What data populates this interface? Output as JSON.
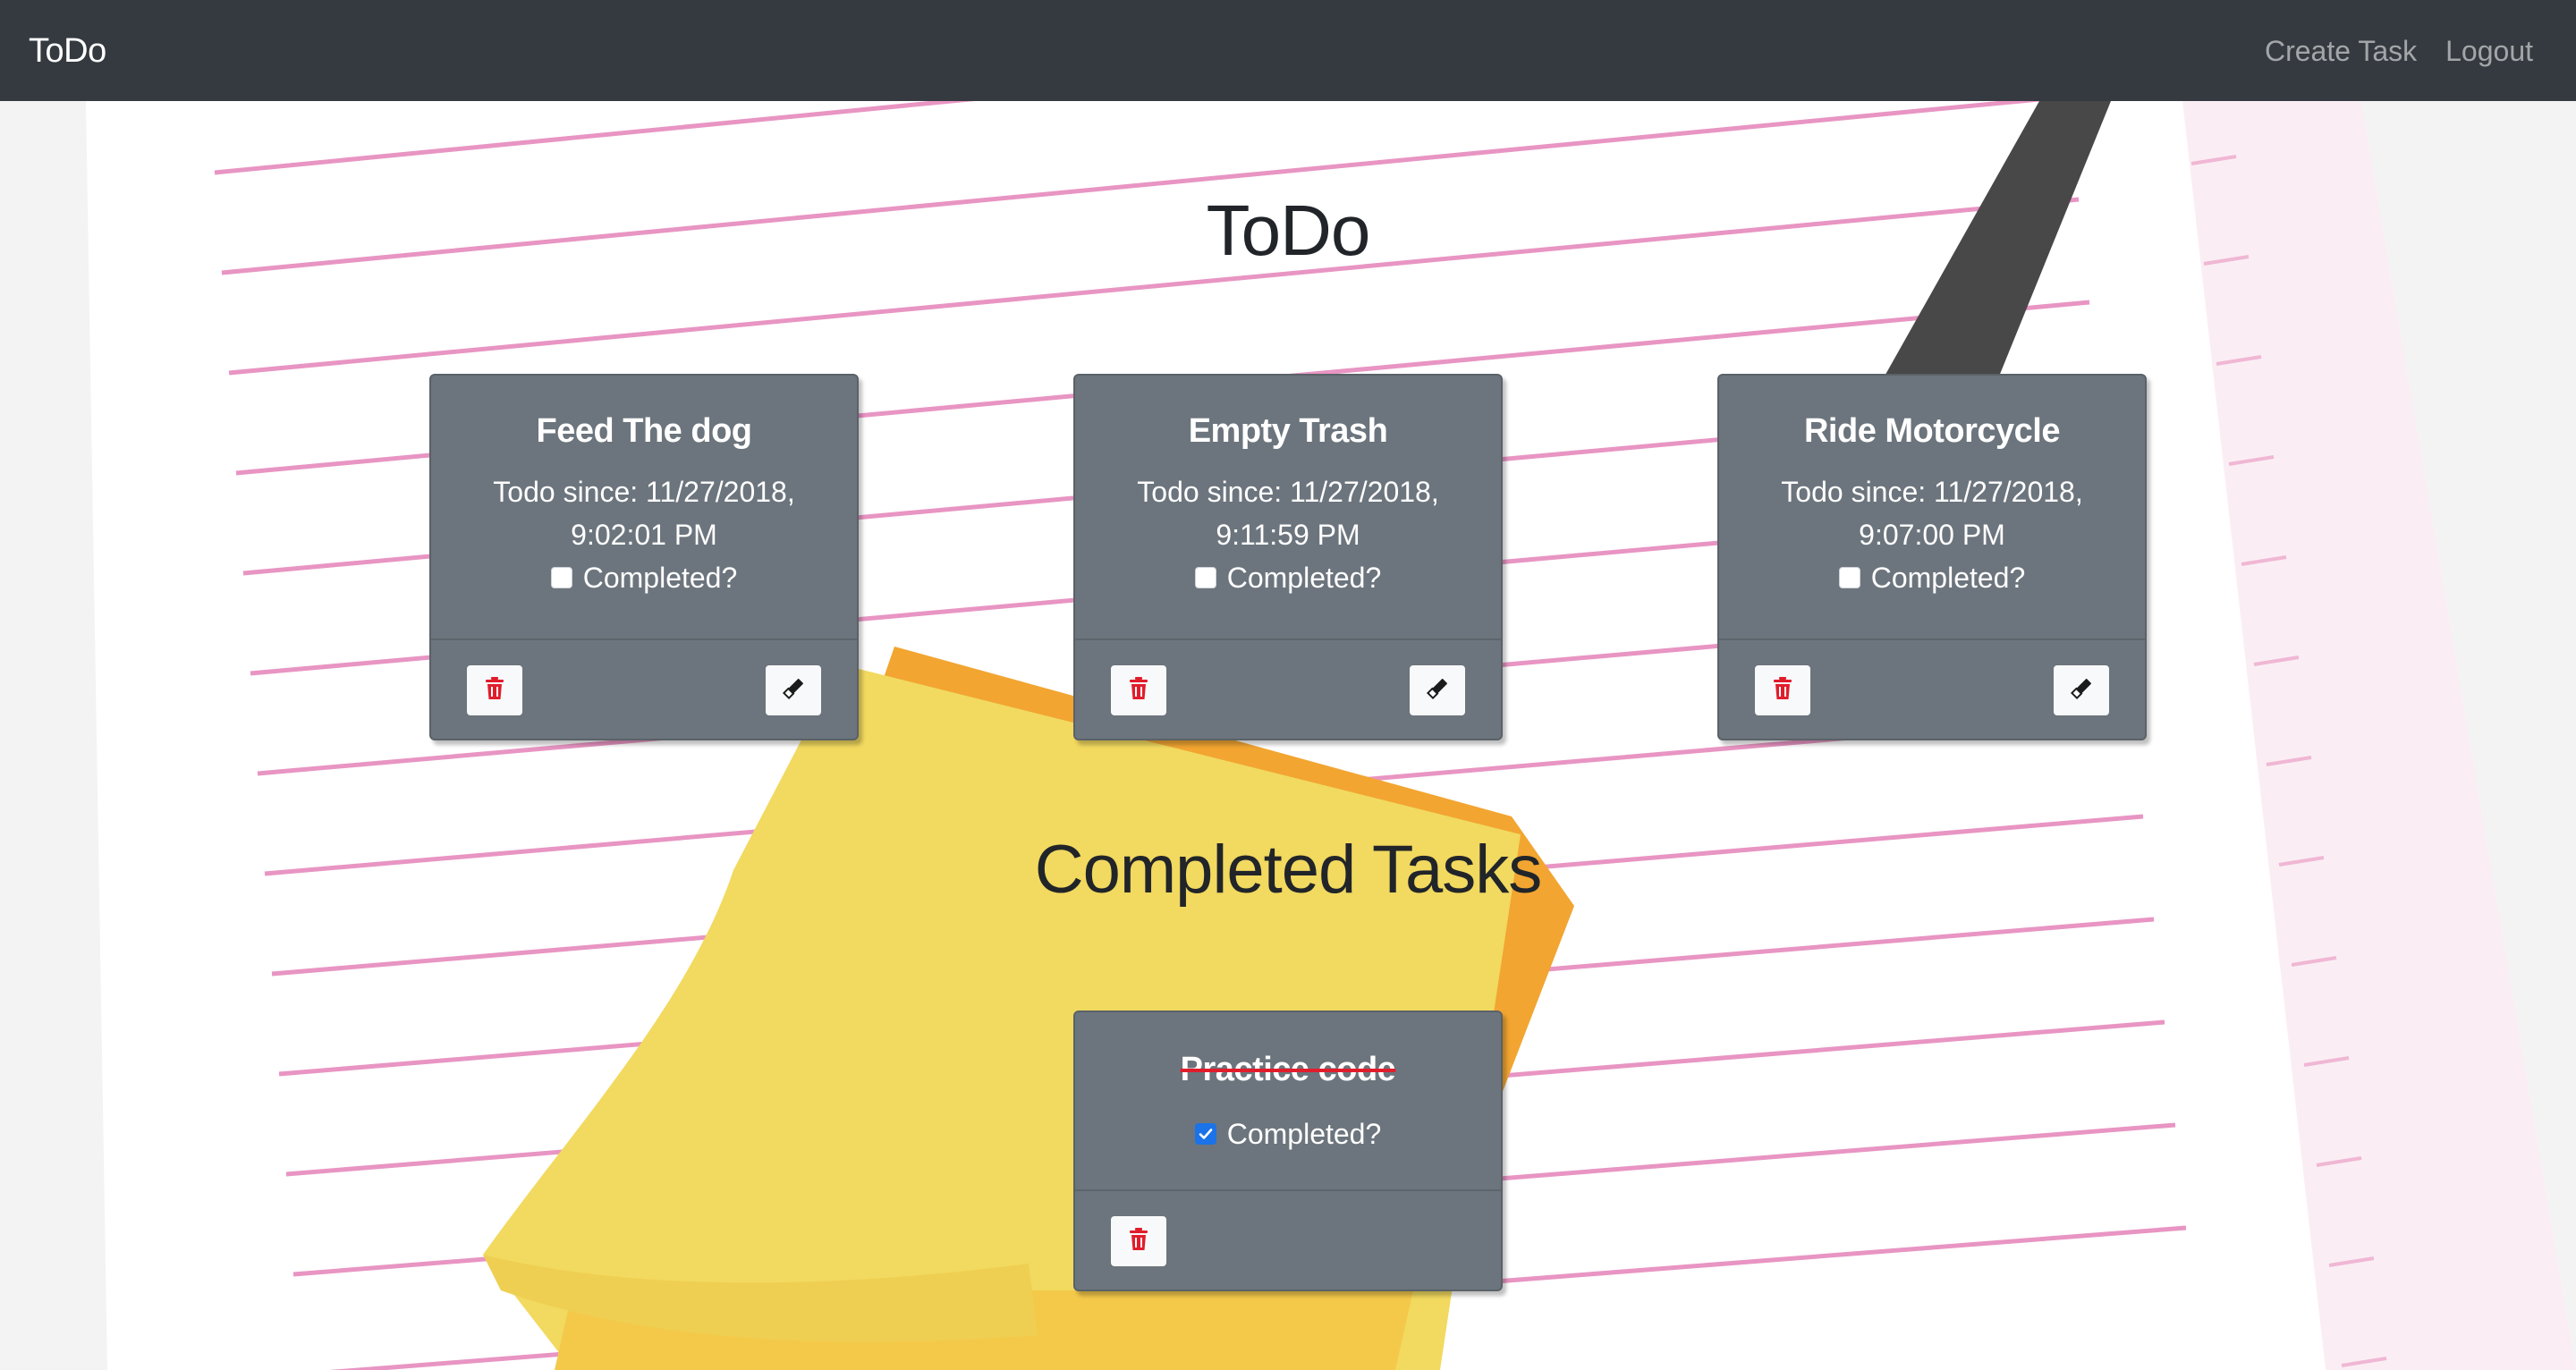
{
  "navbar": {
    "brand": "ToDo",
    "links": [
      "Create Task",
      "Logout"
    ]
  },
  "headings": {
    "todo": "ToDo",
    "completed": "Completed Tasks"
  },
  "todo_cards": [
    {
      "title": "Feed The dog",
      "since_line1": "Todo since: 11/27/2018,",
      "since_line2": "9:02:01 PM",
      "completed_label": "Completed?",
      "checked": false
    },
    {
      "title": "Empty Trash",
      "since_line1": "Todo since: 11/27/2018,",
      "since_line2": "9:11:59 PM",
      "completed_label": "Completed?",
      "checked": false
    },
    {
      "title": "Ride Motorcycle",
      "since_line1": "Todo since: 11/27/2018,",
      "since_line2": "9:07:00 PM",
      "completed_label": "Completed?",
      "checked": false
    }
  ],
  "completed_cards": [
    {
      "title": "Practice code",
      "completed_label": "Completed?",
      "checked": true
    }
  ],
  "icons": {
    "delete": "trash-icon",
    "edit": "eraser-icon"
  },
  "colors": {
    "navbar": "#343a40",
    "card": "#6c757d",
    "delete": "#e11d2c",
    "checkbox_checked": "#1a73e8",
    "sticky_note": "#f2d95f",
    "paper_lines": "#e88fc0"
  }
}
